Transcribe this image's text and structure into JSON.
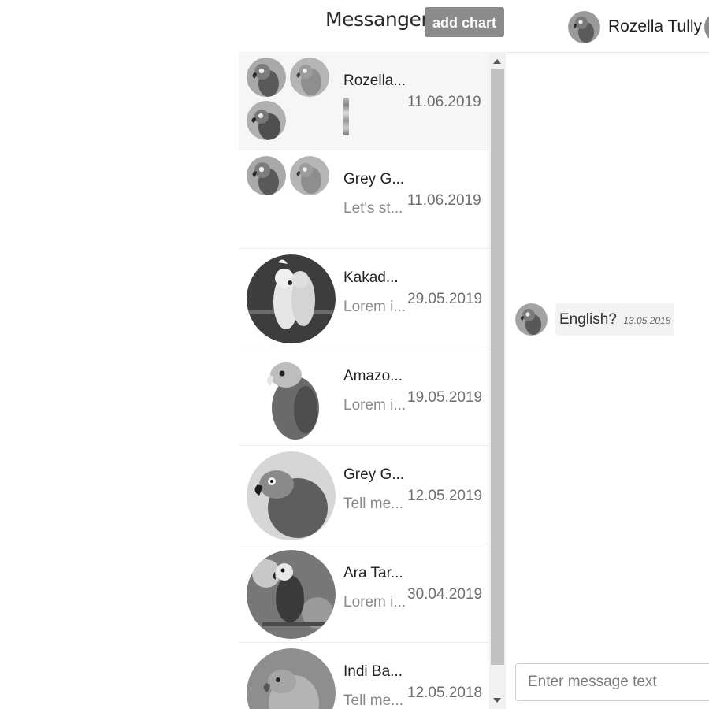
{
  "header": {
    "title": "Messanger",
    "add_chart_label": "add chart"
  },
  "chat_header": {
    "name": "Rozella Tully",
    "avatar_icon": "parrot-avatar-icon"
  },
  "chats": [
    {
      "name": "Rozella...",
      "preview": "",
      "date": "11.06.2019",
      "selected": true,
      "avatar": "group-parrot-avatars"
    },
    {
      "name": "Grey G...",
      "preview": "Let's st...",
      "date": "11.06.2019",
      "selected": false,
      "avatar": "group-parrot-avatars"
    },
    {
      "name": "Kakad...",
      "preview": "Lorem i...",
      "date": "29.05.2019",
      "selected": false,
      "avatar": "cockatoo-avatar"
    },
    {
      "name": "Amazo...",
      "preview": "Lorem i...",
      "date": "19.05.2019",
      "selected": false,
      "avatar": "amazon-parrot-avatar"
    },
    {
      "name": "Grey G...",
      "preview": "Tell me...",
      "date": "12.05.2019",
      "selected": false,
      "avatar": "grey-parrot-avatar"
    },
    {
      "name": "Ara Tar...",
      "preview": "Lorem i...",
      "date": "30.04.2019",
      "selected": false,
      "avatar": "macaw-avatar"
    },
    {
      "name": "Indi Ba...",
      "preview": "Tell me...",
      "date": "12.05.2018",
      "selected": false,
      "avatar": "parakeet-avatar"
    }
  ],
  "message": {
    "text": "English?",
    "time": "13.05.2018"
  },
  "composer": {
    "placeholder": "Enter message text"
  }
}
